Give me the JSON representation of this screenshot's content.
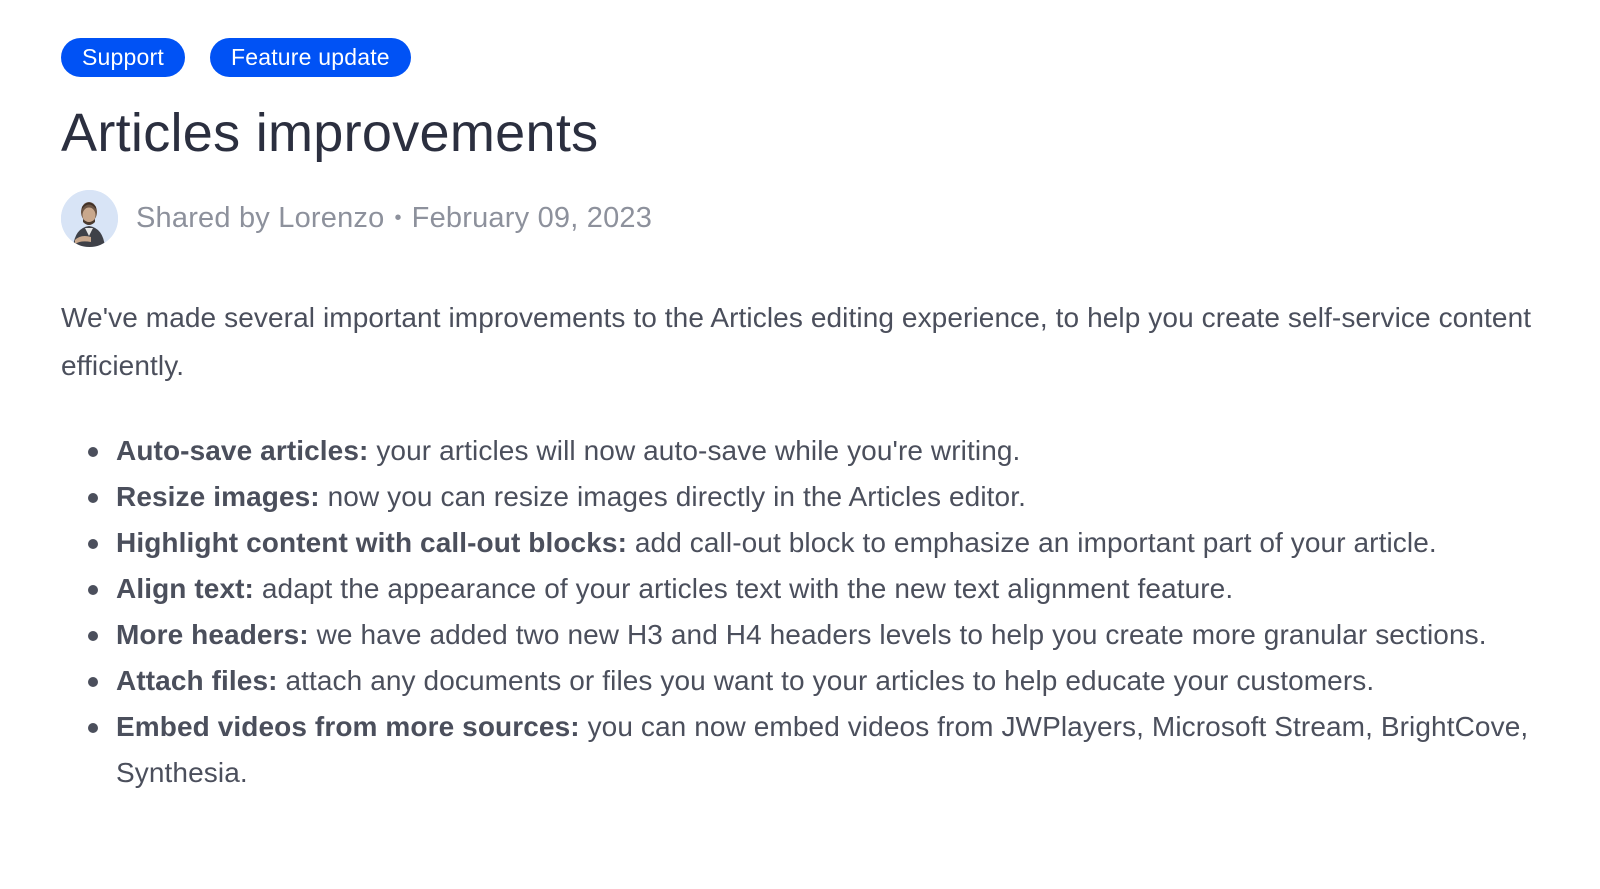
{
  "tags": [
    {
      "label": "Support"
    },
    {
      "label": "Feature update"
    }
  ],
  "article": {
    "title": "Articles improvements",
    "meta": {
      "shared_by": "Shared by Lorenzo",
      "separator": "•",
      "date": "February 09, 2023"
    },
    "intro": "We've made several important improvements to the Articles editing experience, to help you create self-service content efficiently.",
    "features": [
      {
        "title": "Auto-save articles:",
        "text": " your articles will now auto-save while you're writing."
      },
      {
        "title": "Resize images:",
        "text": " now you can resize images directly in the Articles editor."
      },
      {
        "title": "Highlight content with call-out blocks:",
        "text": " add call-out block to emphasize an important part of your article."
      },
      {
        "title": "Align text:",
        "text": " adapt the appearance of your articles text with the new text alignment feature."
      },
      {
        "title": "More headers:",
        "text": " we have added two new H3 and H4 headers levels to help you create more granular sections."
      },
      {
        "title": "Attach files:",
        "text": " attach any documents or files you want to your articles to help educate your customers."
      },
      {
        "title": "Embed videos from more sources:",
        "text": " you can now embed videos from JWPlayers, Microsoft Stream, BrightCove, Synthesia."
      }
    ]
  },
  "colors": {
    "tag_background": "#0052f5",
    "title": "#2b2f3f",
    "body_text": "#4b4f5c",
    "meta_text": "#8d919c"
  },
  "icons": {
    "avatar": "author-avatar-photo"
  }
}
